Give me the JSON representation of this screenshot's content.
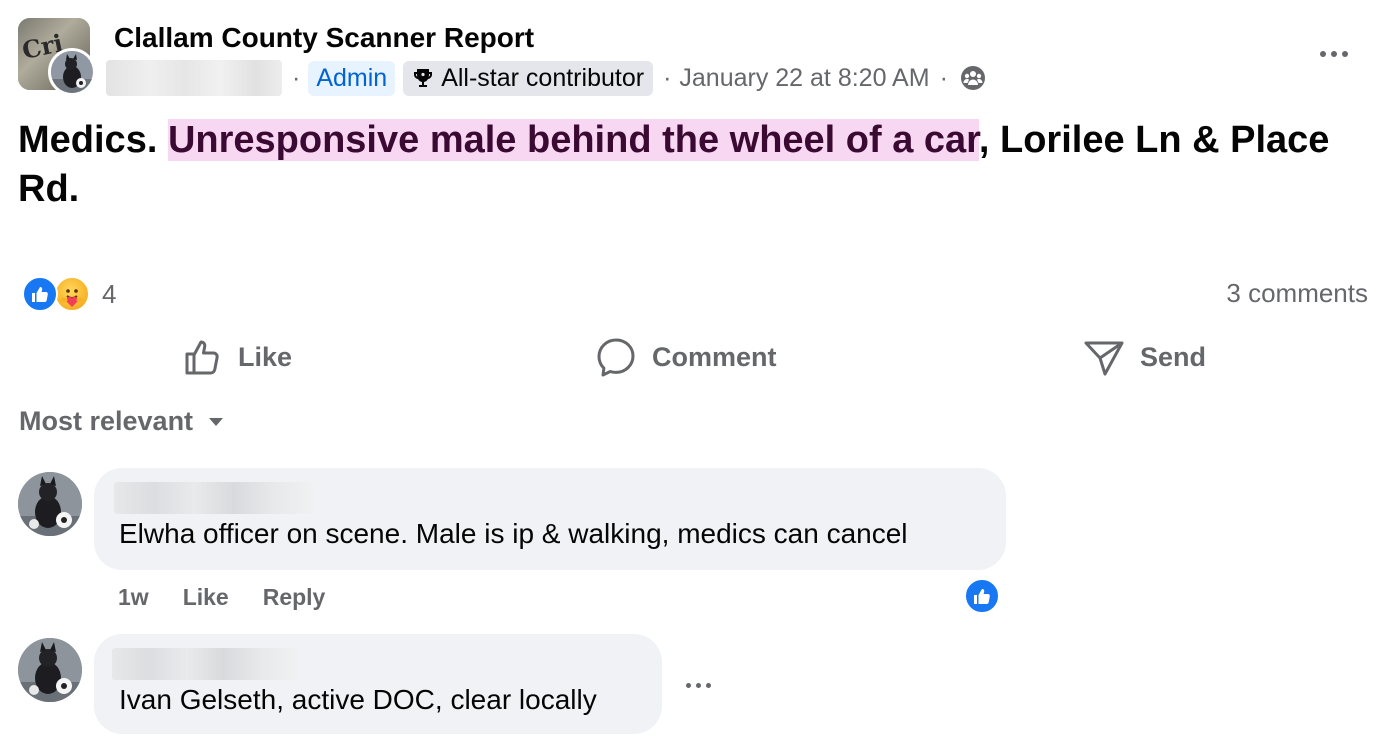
{
  "post": {
    "group_name": "Clallam County Scanner Report",
    "group_avatar_text": "Cri",
    "admin_badge": "Admin",
    "contributor_badge": "All-star contributor",
    "separator": "·",
    "timestamp": "January 22 at 8:20 AM",
    "audience_icon": "group-members-icon",
    "body": {
      "prefix": "Medics. ",
      "highlighted": "Unresponsive male behind the wheel of a car",
      "suffix": ", Lorilee Ln & Place Rd."
    },
    "highlight_color": "#f8d7f2",
    "reaction_icons": [
      "like-icon",
      "care-icon"
    ],
    "reaction_count": "4",
    "comments_count": "3 comments"
  },
  "actions": {
    "like": "Like",
    "comment": "Comment",
    "send": "Send"
  },
  "comments_section": {
    "sort_label": "Most relevant"
  },
  "comments": [
    {
      "text": "Elwha officer on scene. Male is ip & walking, medics can cancel",
      "time": "1w",
      "like": "Like",
      "reply": "Reply",
      "reaction_icon": "like-icon"
    },
    {
      "text": "Ivan Gelseth, active DOC, clear locally"
    }
  ],
  "colors": {
    "accent": "#1877f2",
    "secondary_text": "#65676b",
    "bubble": "#f0f2f5",
    "admin_badge_bg": "#e7f3ff",
    "admin_badge_text": "#0064d1"
  }
}
